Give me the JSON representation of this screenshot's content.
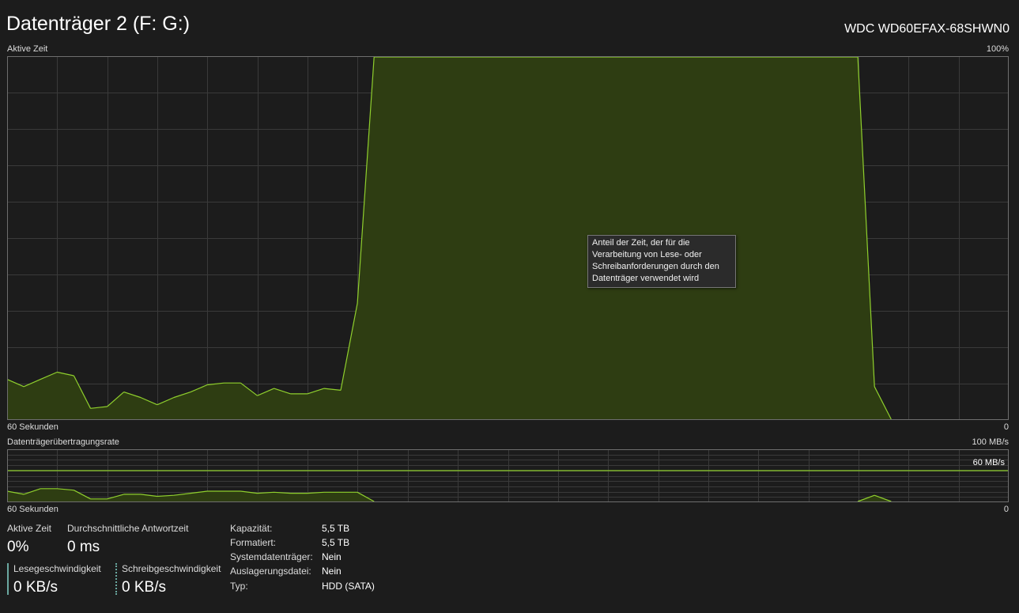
{
  "header": {
    "title": "Datenträger 2 (F: G:)",
    "model": "WDC WD60EFAX-68SHWN0"
  },
  "active_time_graph": {
    "label": "Aktive Zeit",
    "max_label": "100%",
    "time_label": "60 Sekunden",
    "min_label": "0",
    "tooltip": "Anteil der Zeit, der für die Verarbeitung von Lese- oder Schreibanforderungen durch den Datenträger verwendet wird",
    "line_color": "#8fcf2d",
    "fill_color": "#2e3d12"
  },
  "transfer_graph": {
    "label": "Datenträgerübertragungsrate",
    "max_label": "100 MB/s",
    "ref_label": "60 MB/s",
    "time_label": "60 Sekunden",
    "min_label": "0"
  },
  "stats": {
    "active_time": {
      "label": "Aktive Zeit",
      "value": "0%"
    },
    "avg_response": {
      "label": "Durchschnittliche Antwortzeit",
      "value": "0 ms"
    },
    "read_speed": {
      "label": "Lesegeschwindigkeit",
      "value": "0 KB/s"
    },
    "write_speed": {
      "label": "Schreibgeschwindigkeit",
      "value": "0 KB/s"
    }
  },
  "properties": [
    {
      "label": "Kapazität:",
      "value": "5,5 TB"
    },
    {
      "label": "Formatiert:",
      "value": "5,5 TB"
    },
    {
      "label": "Systemdatenträger:",
      "value": "Nein"
    },
    {
      "label": "Auslagerungsdatei:",
      "value": "Nein"
    },
    {
      "label": "Typ:",
      "value": "HDD (SATA)"
    }
  ],
  "chart_data": [
    {
      "type": "area",
      "title": "Aktive Zeit",
      "ylabel": "%",
      "xlabel": "60 Sekunden",
      "ylim": [
        0,
        100
      ],
      "x": [
        60,
        59,
        58,
        57,
        56,
        55,
        54,
        53,
        52,
        51,
        50,
        49,
        48,
        47,
        46,
        45,
        44,
        43,
        42,
        41,
        40,
        39,
        38,
        37,
        36,
        35,
        34,
        33,
        32,
        31,
        30,
        29,
        28,
        27,
        26,
        25,
        24,
        23,
        22,
        21,
        20,
        19,
        18,
        17,
        16,
        15,
        14,
        13,
        12,
        11,
        10,
        9,
        8,
        7,
        6,
        5,
        4,
        3,
        2,
        1,
        0
      ],
      "values": [
        11,
        9,
        11,
        13,
        12,
        3,
        3.5,
        7.5,
        6,
        4,
        6,
        7.5,
        9.5,
        10,
        10,
        6.5,
        8.5,
        7,
        7,
        8.5,
        8,
        32,
        100,
        100,
        100,
        100,
        100,
        100,
        100,
        100,
        100,
        100,
        100,
        100,
        100,
        100,
        100,
        100,
        100,
        100,
        100,
        100,
        100,
        100,
        100,
        100,
        100,
        100,
        100,
        100,
        100,
        100,
        9,
        0,
        0,
        0,
        0,
        0,
        0,
        0,
        0
      ]
    },
    {
      "type": "area",
      "title": "Datenträgerübertragungsrate",
      "ylabel": "MB/s",
      "xlabel": "60 Sekunden",
      "ylim": [
        0,
        100
      ],
      "reference_line": 60,
      "x": [
        60,
        59,
        58,
        57,
        56,
        55,
        54,
        53,
        52,
        51,
        50,
        49,
        48,
        47,
        46,
        45,
        44,
        43,
        42,
        41,
        40,
        39,
        38,
        37,
        36,
        35,
        34,
        33,
        32,
        31,
        30,
        29,
        28,
        27,
        26,
        25,
        24,
        23,
        22,
        21,
        20,
        19,
        18,
        17,
        16,
        15,
        14,
        13,
        12,
        11,
        10,
        9,
        8,
        7,
        6,
        5,
        4,
        3,
        2,
        1,
        0
      ],
      "values": [
        20,
        14,
        25,
        25,
        22,
        5,
        5,
        14,
        14,
        10,
        12,
        16,
        20,
        20,
        20,
        16,
        18,
        16,
        16,
        18,
        18,
        18,
        0,
        0,
        0,
        0,
        0,
        0,
        0,
        0,
        0,
        0,
        0,
        0,
        0,
        0,
        0,
        0,
        0,
        0,
        0,
        0,
        0,
        0,
        0,
        0,
        0,
        0,
        0,
        0,
        0,
        0,
        12,
        0,
        0,
        0,
        0,
        0,
        0,
        0,
        0
      ]
    }
  ]
}
